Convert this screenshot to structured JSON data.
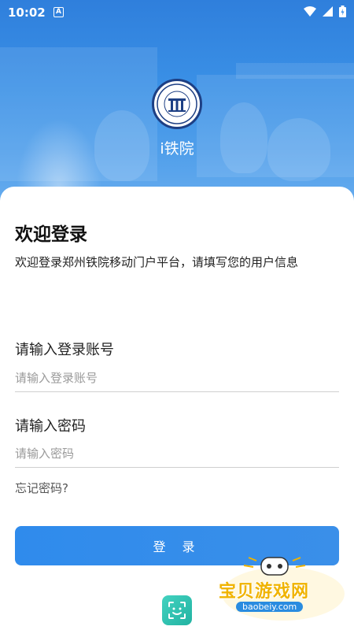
{
  "status_bar": {
    "time": "10:02",
    "notification_badge": "A"
  },
  "header": {
    "app_name": "i铁院",
    "logo_icon": "university-seal-icon"
  },
  "login": {
    "title": "欢迎登录",
    "subtitle": "欢迎登录郑州铁院移动门户平台，请填写您的用户信息",
    "account_label": "请输入登录账号",
    "account_placeholder": "请输入登录账号",
    "account_value": "",
    "password_label": "请输入密码",
    "password_placeholder": "请输入密码",
    "password_value": "",
    "forgot_label": "忘记密码?",
    "login_button_label": "登 录",
    "face_login_icon": "face-scan-icon"
  },
  "watermark": {
    "text": "宝贝游戏网",
    "url": "baobeiy.com"
  },
  "colors": {
    "primary": "#2f8bec",
    "accent_teal": "#2cc0ad",
    "watermark_gold": "#f0b300"
  }
}
